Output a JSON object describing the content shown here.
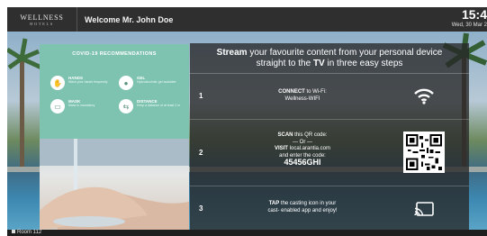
{
  "topbar": {
    "brand_main": "WELLNESS",
    "brand_sub": "HOTELS",
    "welcome": "Welcome Mr. John Doe",
    "time": "15:4",
    "date": "Wed, 30 Mar 2"
  },
  "covid": {
    "title": "COVID-19 RECOMMENDATIONS",
    "items": [
      {
        "head": "HANDS",
        "sub": "Wash your hands frequently",
        "icon": "hand-wash-icon"
      },
      {
        "head": "GEL",
        "sub": "Hydroalcoholic gel available",
        "icon": "sanitizer-gel-icon"
      },
      {
        "head": "MASK",
        "sub": "Mask is mandatory",
        "icon": "mask-icon"
      },
      {
        "head": "DISTANCE",
        "sub": "Keep a distance of at least 2 m",
        "icon": "distance-icon"
      }
    ]
  },
  "panel": {
    "header_bold_1": "Stream",
    "header_rest_1": " your favourite content from your personal device",
    "header_line2_pre": "straight to the ",
    "header_bold_2": "TV",
    "header_line2_post": " in three easy steps",
    "steps": [
      {
        "num": "1",
        "bold": "CONNECT",
        "text": " to Wi-Fi:",
        "line2": "Wellness-WIFI",
        "icon": "wifi-icon"
      },
      {
        "num": "2",
        "bold": "SCAN",
        "text": " this QR code:",
        "or": "— Or —",
        "visit_bold": "VISIT",
        "visit_text": " local.arantia.com",
        "line3": "and enter the code:",
        "code": "45456GHI",
        "icon": "qr-code-icon"
      },
      {
        "num": "3",
        "bold": "TAP",
        "text": " the casting icon in your",
        "line2": "cast- enabled app and enjoy!",
        "icon": "cast-icon"
      }
    ]
  },
  "bottombar": {
    "room": "Room 112"
  },
  "colors": {
    "covid_card": "#7ec3b0",
    "topbar": "#2f2f2f",
    "panel": "#282828"
  }
}
